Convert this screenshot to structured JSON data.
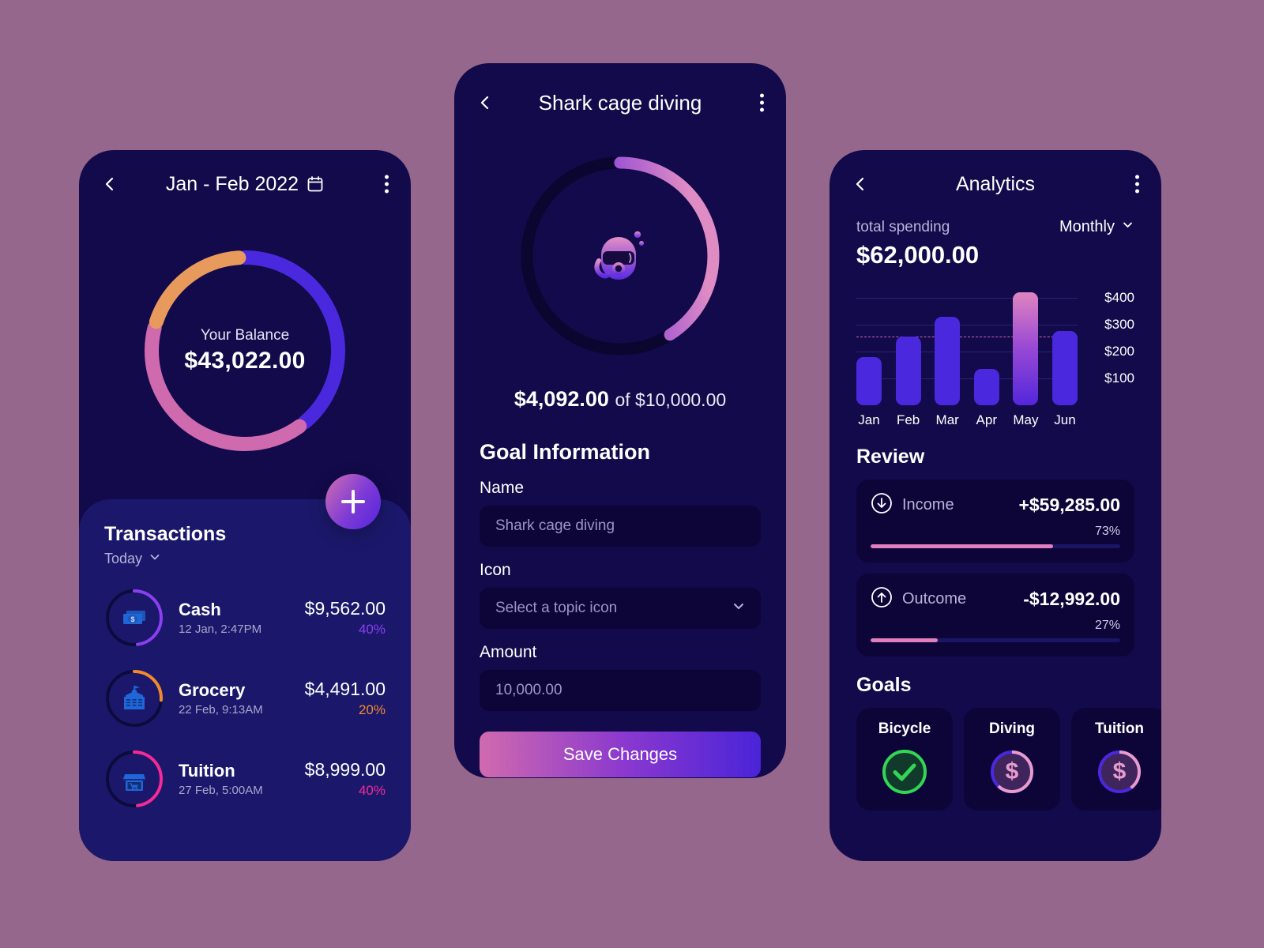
{
  "balance_screen": {
    "back_icon": "chevron-left-icon",
    "title": "Jan - Feb 2022",
    "calendar_icon": "calendar-icon",
    "menu_icon": "kebab-menu-icon",
    "donut": {
      "label": "Your Balance",
      "value": "$43,022.00",
      "segments": [
        {
          "name": "purple",
          "percent": 40,
          "color": "#4a28de"
        },
        {
          "name": "pink",
          "percent": 40,
          "color": "#d06aae"
        },
        {
          "name": "orange",
          "percent": 20,
          "color": "#e89a5c"
        }
      ]
    },
    "add_button": {
      "icon": "plus-icon",
      "label": "Add transaction"
    },
    "transactions": {
      "title": "Transactions",
      "filter": "Today",
      "filter_icon": "chevron-down-icon",
      "items": [
        {
          "name": "Cash",
          "date": "12 Jan, 2:47PM",
          "amount": "$9,562.00",
          "percent": "40%",
          "color": "#8a3ff0",
          "ring_percent": 48,
          "icon": "banknote-icon"
        },
        {
          "name": "Grocery",
          "date": "22 Feb, 9:13AM",
          "amount": "$4,491.00",
          "percent": "20%",
          "color": "#f08a2c",
          "ring_percent": 26,
          "icon": "school-building-icon"
        },
        {
          "name": "Tuition",
          "date": "27 Feb, 5:00AM",
          "amount": "$8,999.00",
          "percent": "40%",
          "color": "#f52a96",
          "ring_percent": 48,
          "icon": "storefront-icon"
        }
      ]
    }
  },
  "goal_screen": {
    "back_icon": "chevron-left-icon",
    "title": "Shark cage diving",
    "menu_icon": "kebab-menu-icon",
    "progress": {
      "percent": 41,
      "icon": "diving-mask-icon"
    },
    "saved_amount": "$4,092.00",
    "target_text": "of $10,000.00",
    "section_title": "Goal Information",
    "fields": [
      {
        "label": "Name",
        "value": "Shark cage diving",
        "type": "text"
      },
      {
        "label": "Icon",
        "value": "Select a topic icon",
        "type": "select",
        "icon": "chevron-down-icon"
      },
      {
        "label": "Amount",
        "value": "10,000.00",
        "type": "text"
      }
    ],
    "save_label": "Save Changes"
  },
  "analytics_screen": {
    "back_icon": "chevron-left-icon",
    "title": "Analytics",
    "menu_icon": "kebab-menu-icon",
    "spending_label": "total spending",
    "spending_value": "$62,000.00",
    "period": "Monthly",
    "period_icon": "chevron-down-icon",
    "review_title": "Review",
    "review": [
      {
        "name": "Income",
        "icon": "arrow-down-circle-icon",
        "amount": "+$59,285.00",
        "percent": "73%",
        "percent_value": 73
      },
      {
        "name": "Outcome",
        "icon": "arrow-up-circle-icon",
        "amount": "-$12,992.00",
        "percent": "27%",
        "percent_value": 27
      }
    ],
    "goals_title": "Goals",
    "goals": [
      {
        "name": "Bicycle",
        "state": "complete",
        "icon": "check-circle-icon",
        "ring_percent": 100
      },
      {
        "name": "Diving",
        "state": "in-progress",
        "icon": "dollar-circle-icon",
        "ring_percent": 62
      },
      {
        "name": "Tuition",
        "state": "in-progress",
        "icon": "dollar-circle-icon",
        "ring_percent": 40
      }
    ]
  },
  "chart_data": {
    "type": "bar",
    "title": "total spending",
    "categories": [
      "Jan",
      "Feb",
      "Mar",
      "Apr",
      "May",
      "Jun"
    ],
    "values": [
      180,
      255,
      330,
      135,
      420,
      275
    ],
    "highlight_index": 4,
    "ytick_labels": [
      "$400",
      "$300",
      "$200",
      "$100"
    ],
    "yticks": [
      400,
      300,
      200,
      100
    ],
    "ylim": [
      0,
      440
    ],
    "average_line": 255,
    "grid": true,
    "xlabel": "",
    "ylabel": ""
  }
}
